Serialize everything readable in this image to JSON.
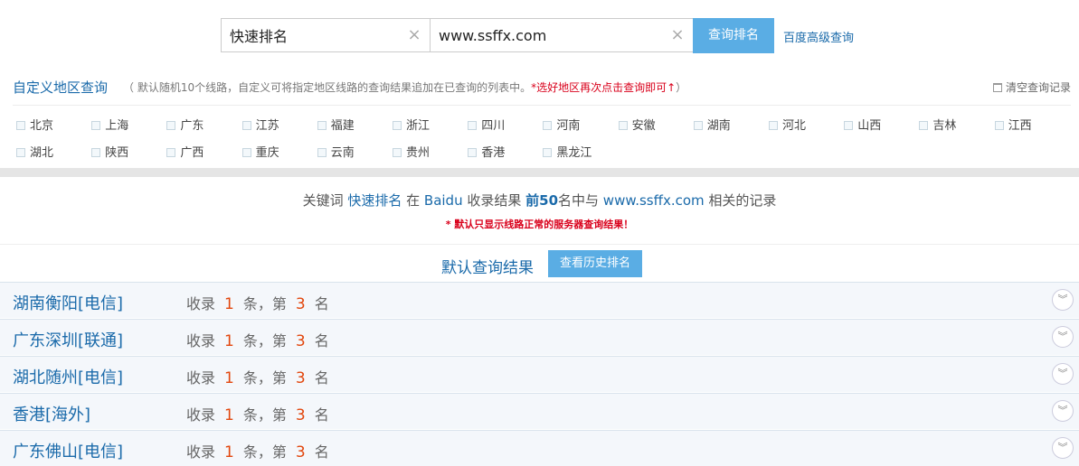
{
  "search": {
    "keyword": "快速排名",
    "site": "www.ssffx.com",
    "query_button": "查询排名",
    "advanced_link": "百度高级查询",
    "clear_icon": "×"
  },
  "region": {
    "title": "自定义地区查询",
    "note_prefix": "（ 默认随机10个线路，自定义可将指定地区线路的查询结果追加在已查询的列表中。",
    "note_red": "*选好地区再次点击查询即可↑",
    "note_suffix": "）",
    "clear_records": "清空查询记录",
    "items": [
      "北京",
      "上海",
      "广东",
      "江苏",
      "福建",
      "浙江",
      "四川",
      "河南",
      "安徽",
      "湖南",
      "河北",
      "山西",
      "吉林",
      "江西",
      "湖北",
      "陕西",
      "广西",
      "重庆",
      "云南",
      "贵州",
      "香港",
      "黑龙江"
    ]
  },
  "summary": {
    "p1": "关键词 ",
    "keyword": "快速排名",
    "p2": " 在 ",
    "engine": "Baidu",
    "p3": " 收录结果 ",
    "top": "前50",
    "p4": "名中与 ",
    "site": "www.ssffx.com",
    "p5": " 相关的记录",
    "warning": "* 默认只显示线路正常的服务器查询结果！"
  },
  "results": {
    "title": "默认查询结果",
    "history_button": "查看历史排名",
    "label_record": "收录",
    "label_count_unit": "条，第",
    "label_rank_unit": "名",
    "expand_icon": "chevron-double-down",
    "rows": [
      {
        "location": "湖南衡阳[电信]",
        "count": "1",
        "rank": "3"
      },
      {
        "location": "广东深圳[联通]",
        "count": "1",
        "rank": "3"
      },
      {
        "location": "湖北随州[电信]",
        "count": "1",
        "rank": "3"
      },
      {
        "location": "香港[海外]",
        "count": "1",
        "rank": "3"
      },
      {
        "location": "广东佛山[电信]",
        "count": "1",
        "rank": "3"
      }
    ]
  },
  "colors": {
    "accent_blue": "#5aade4",
    "link_blue": "#1a6aaa",
    "red": "#d9001b",
    "number_orange": "#e2470e"
  }
}
